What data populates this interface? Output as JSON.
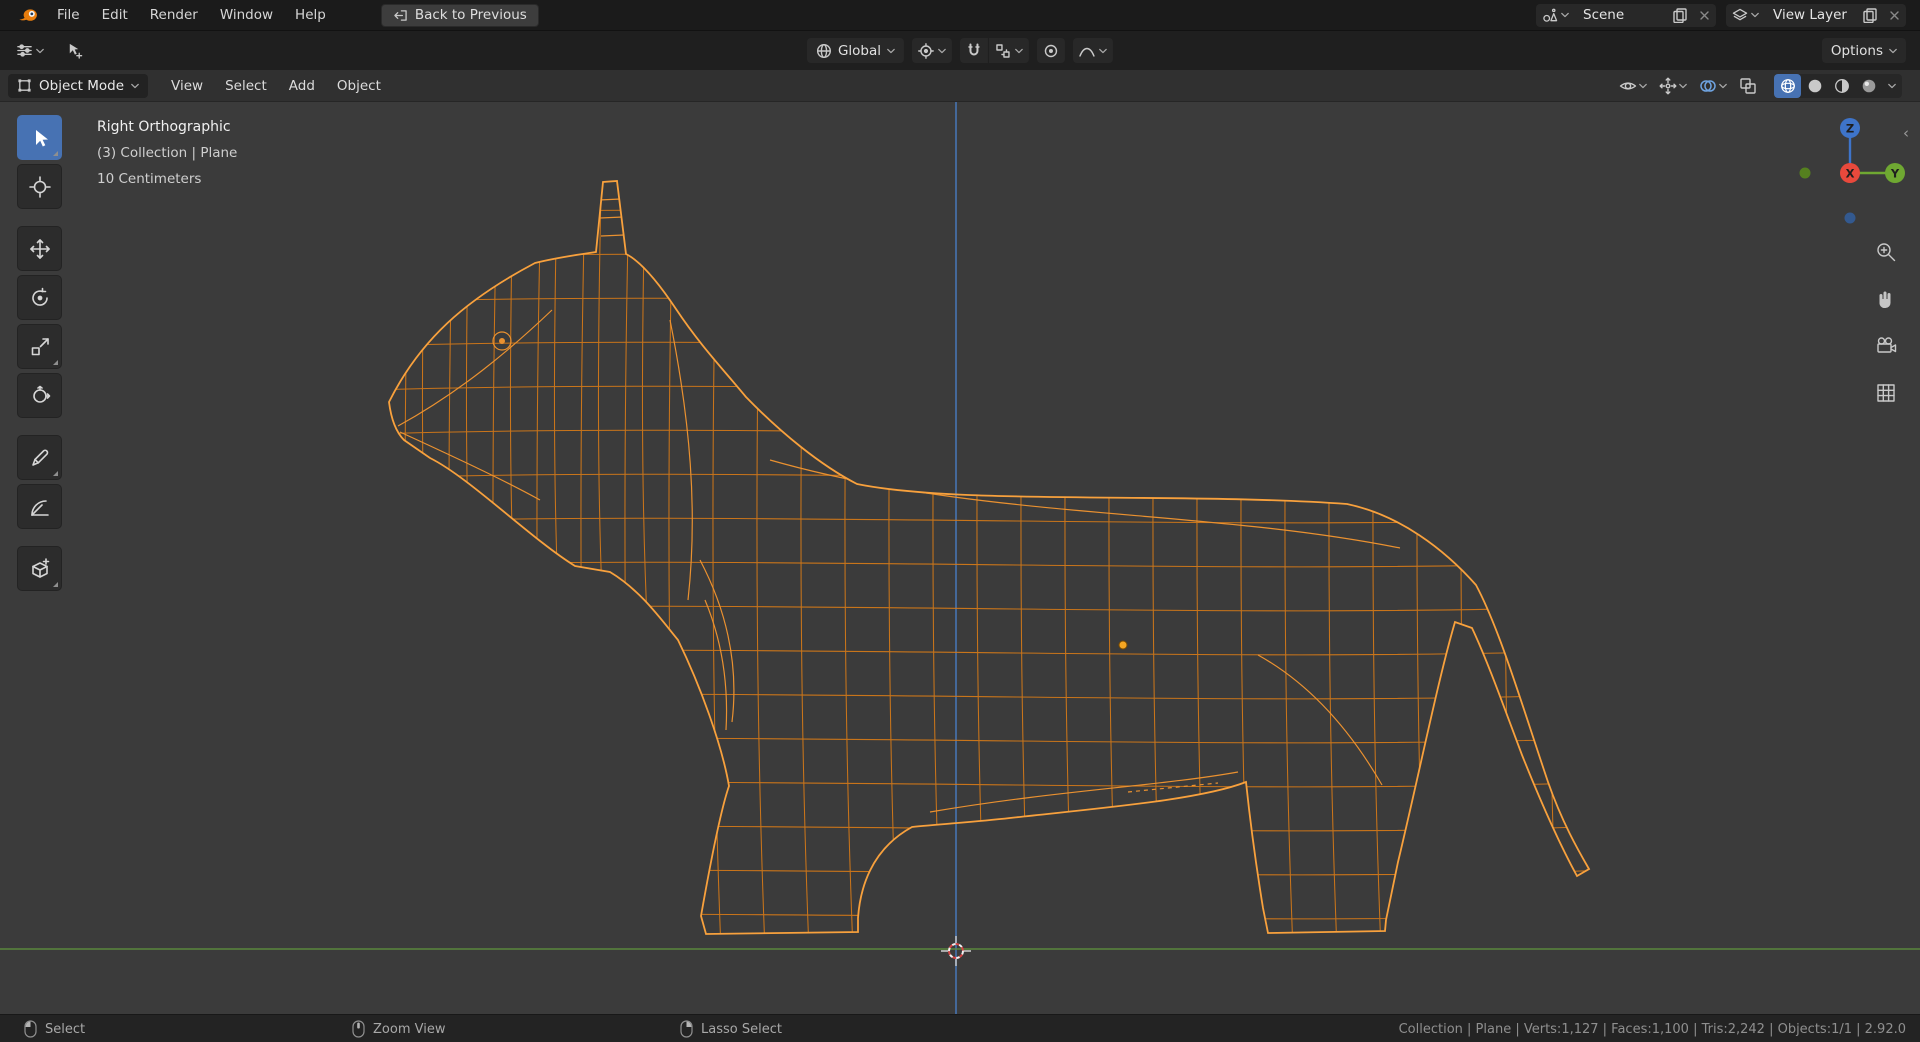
{
  "topbar": {
    "menus": [
      {
        "label": "File"
      },
      {
        "label": "Edit"
      },
      {
        "label": "Render"
      },
      {
        "label": "Window"
      },
      {
        "label": "Help"
      }
    ],
    "back_button_label": "Back to Previous",
    "scene_selector": {
      "value": "Scene"
    },
    "view_layer_selector": {
      "value": "View Layer"
    }
  },
  "tool_settings": {
    "orientation_value": "Global",
    "options_label": "Options"
  },
  "viewport": {
    "header": {
      "mode_value": "Object Mode",
      "menus": [
        {
          "label": "View"
        },
        {
          "label": "Select"
        },
        {
          "label": "Add"
        },
        {
          "label": "Object"
        }
      ]
    },
    "overlay": {
      "line1": "Right Orthographic",
      "line2": "(3) Collection | Plane",
      "line3": "10 Centimeters"
    },
    "axis_gizmo": {
      "x": "X",
      "y": "Y",
      "z": "Z"
    }
  },
  "left_toolbar": {
    "tools": [
      "select-box",
      "cursor",
      "move",
      "rotate",
      "scale",
      "transform",
      "annotate",
      "measure",
      "add-cube"
    ],
    "active_tool": "select-box"
  },
  "statusbar": {
    "hints": [
      {
        "icon": "mouse-left",
        "label": "Select"
      },
      {
        "icon": "mouse-middle",
        "label": "Zoom View"
      },
      {
        "icon": "mouse-right",
        "label": "Lasso Select"
      }
    ],
    "info": "Collection | Plane | Verts:1,127 | Faces:1,100 | Tris:2,242 | Objects:1/1 | 2.92.0"
  },
  "colors": {
    "accent_blue": "#4772b3",
    "wire_orange": "#d67a18",
    "outline_orange": "#f8a13d",
    "axis_x": "#e8493c",
    "axis_y": "#6fa832",
    "axis_z": "#3e74c9",
    "z_axis_line": "#4878b8",
    "floor_line": "#5c8c3e"
  }
}
